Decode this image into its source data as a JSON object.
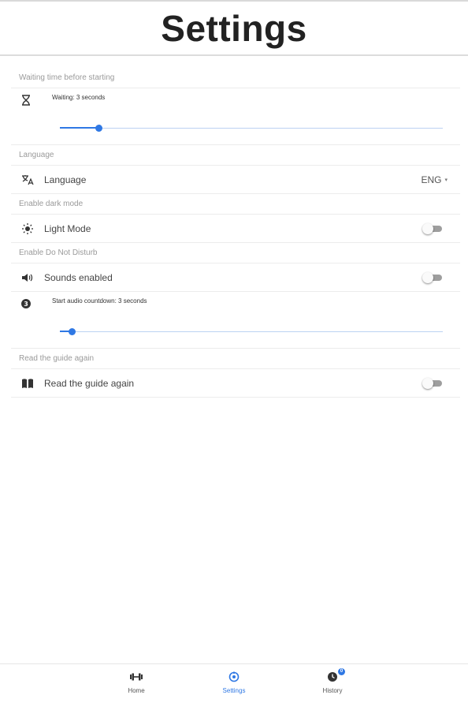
{
  "header": {
    "title": "Settings"
  },
  "sections": {
    "waiting": {
      "label": "Waiting time before starting",
      "caption": "Waiting: 3 seconds",
      "slider_fraction": 0.1
    },
    "language": {
      "label": "Language",
      "row_label": "Language",
      "value": "ENG",
      "chevron": "▾"
    },
    "dark_mode": {
      "label": "Enable dark mode",
      "row_label": "Light Mode",
      "toggle_on": false
    },
    "dnd": {
      "label": "Enable Do Not Disturb",
      "sounds_label": "Sounds enabled",
      "sounds_on": false,
      "countdown_caption": "Start audio countdown: 3 seconds",
      "countdown_fraction": 0.03
    },
    "guide": {
      "label": "Read the guide again",
      "row_label": "Read the guide again",
      "toggle_on": false
    }
  },
  "nav": {
    "items": [
      {
        "label": "Home",
        "icon": "dumbbell-icon",
        "active": false
      },
      {
        "label": "Settings",
        "icon": "gear-icon",
        "active": true
      },
      {
        "label": "History",
        "icon": "history-icon",
        "active": false,
        "badge": "0"
      }
    ]
  },
  "colors": {
    "accent": "#2f78e4",
    "track": "#bcd2f2",
    "toggle_off": "#9e9e9e"
  }
}
